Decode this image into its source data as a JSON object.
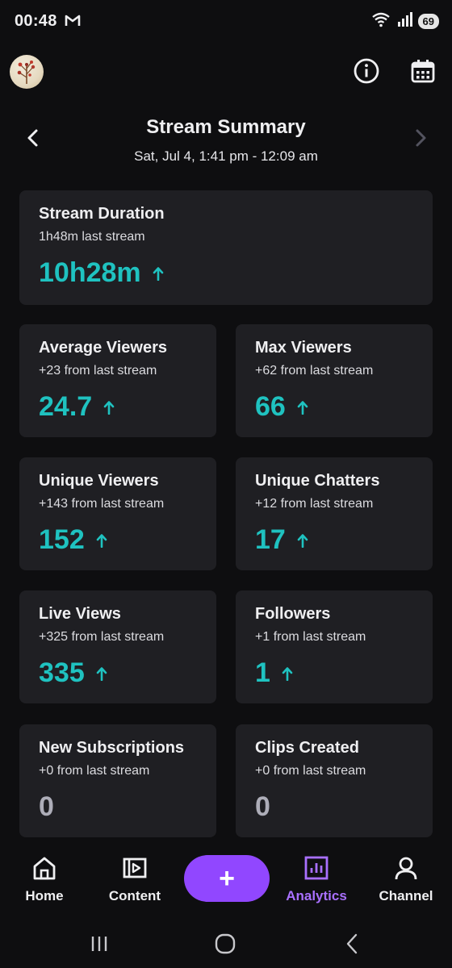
{
  "status_bar": {
    "time": "00:48",
    "battery": "69"
  },
  "header": {
    "title": "Stream Summary",
    "subtitle": "Sat, Jul 4, 1:41 pm - 12:09 am"
  },
  "icons": {
    "avatar": "avatar",
    "info": "info-icon",
    "calendar": "calendar-icon",
    "prev": "chevron-left-icon",
    "next": "chevron-right-icon",
    "trend": "arrow-up-icon"
  },
  "colors": {
    "accent_teal": "#1fc2c0",
    "accent_purple": "#9147ff",
    "active_nav": "#a970ff",
    "card_bg": "#1f1f23",
    "background": "#0e0e10"
  },
  "stats": [
    {
      "title": "Stream Duration",
      "sub": "1h48m last stream",
      "value": "10h28m",
      "trend": "up"
    },
    {
      "title": "Average Viewers",
      "sub": "+23 from last stream",
      "value": "24.7",
      "trend": "up"
    },
    {
      "title": "Max Viewers",
      "sub": "+62 from last stream",
      "value": "66",
      "trend": "up"
    },
    {
      "title": "Unique Viewers",
      "sub": "+143 from last stream",
      "value": "152",
      "trend": "up"
    },
    {
      "title": "Unique Chatters",
      "sub": "+12 from last stream",
      "value": "17",
      "trend": "up"
    },
    {
      "title": "Live Views",
      "sub": "+325 from last stream",
      "value": "335",
      "trend": "up"
    },
    {
      "title": "Followers",
      "sub": "+1 from last stream",
      "value": "1",
      "trend": "up"
    },
    {
      "title": "New Subscriptions",
      "sub": "+0 from last stream",
      "value": "0",
      "trend": "none"
    },
    {
      "title": "Clips Created",
      "sub": "+0 from last stream",
      "value": "0",
      "trend": "none"
    }
  ],
  "bottom_nav": {
    "items": [
      {
        "label": "Home",
        "icon": "home-icon"
      },
      {
        "label": "Content",
        "icon": "content-icon"
      },
      {
        "label": "Analytics",
        "icon": "analytics-icon",
        "active": true
      },
      {
        "label": "Channel",
        "icon": "profile-icon"
      }
    ],
    "create_label": "+"
  }
}
